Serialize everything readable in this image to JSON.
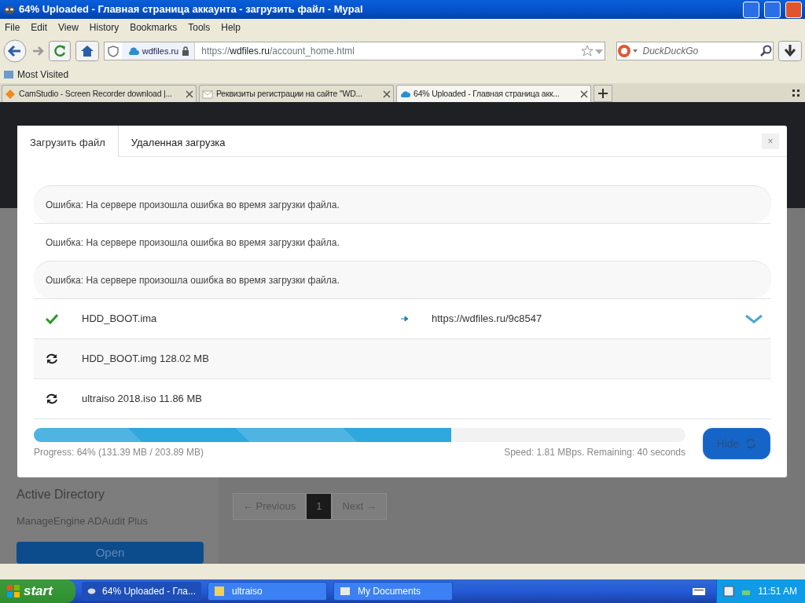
{
  "window": {
    "title": "64% Uploaded - Главная страница аккаунта - загрузить файл - Mypal"
  },
  "menu": [
    "File",
    "Edit",
    "View",
    "History",
    "Bookmarks",
    "Tools",
    "Help"
  ],
  "address": {
    "site": "wdfiles.ru",
    "url": "https://**wdfiles.ru**/account_home.html"
  },
  "search": {
    "placeholder": "DuckDuckGo"
  },
  "bookmarks": [
    "Most Visited"
  ],
  "tabs": [
    {
      "label": "CamStudio - Screen Recorder download |...",
      "selected": false,
      "kind": "cam"
    },
    {
      "label": "Реквизиты регистрации на сайте \"WD...",
      "selected": false,
      "kind": "mail"
    },
    {
      "label": "64% Uploaded - Главная страница акк...",
      "selected": true,
      "kind": "cloud"
    }
  ],
  "page": {
    "ad_text": "Active Directory",
    "ad_brand": "ManageEngine ADAudit Plus",
    "ad_button": "Open",
    "pagination": [
      {
        "label": "← Previous",
        "selected": false
      },
      {
        "label": "1",
        "selected": true
      },
      {
        "label": "Next →",
        "selected": false
      }
    ]
  },
  "modal": {
    "tabs": [
      {
        "label": "Загрузить файл",
        "selected": true
      },
      {
        "label": "Удаленная загрузка",
        "selected": false
      }
    ],
    "close": "×",
    "messages": [
      "Ошибка: На сервере произошла ошибка во время загрузки файла.",
      "Ошибка: На сервере произошла ошибка во время загрузки файла.",
      "Ошибка: На сервере произошла ошибка во время загрузки файла."
    ],
    "files": [
      {
        "kind": "done",
        "name": "HDD_BOOT.ima",
        "link": "https://wdfiles.ru/9c8547"
      },
      {
        "kind": "pending",
        "name": "HDD_BOOT.img  128.02 MB"
      },
      {
        "kind": "pending",
        "name": "ultraiso 2018.iso  11.86 MB"
      }
    ],
    "progress": {
      "level": 0.64,
      "status": "Progress: 64% (131.39 MB / 203.89 MB)",
      "speed": "Speed: 1.81 MBps. Remaining: 40 seconds"
    },
    "hide_button": "Hide"
  },
  "taskbar": {
    "start": "start",
    "tasks": [
      {
        "label": "64% Uploaded - Гла...",
        "selected": true,
        "kind": "browser"
      },
      {
        "label": "ultraiso",
        "selected": false,
        "kind": "folder"
      },
      {
        "label": "My Documents",
        "selected": false,
        "kind": "docs"
      }
    ],
    "clock": "11:51 AM"
  }
}
